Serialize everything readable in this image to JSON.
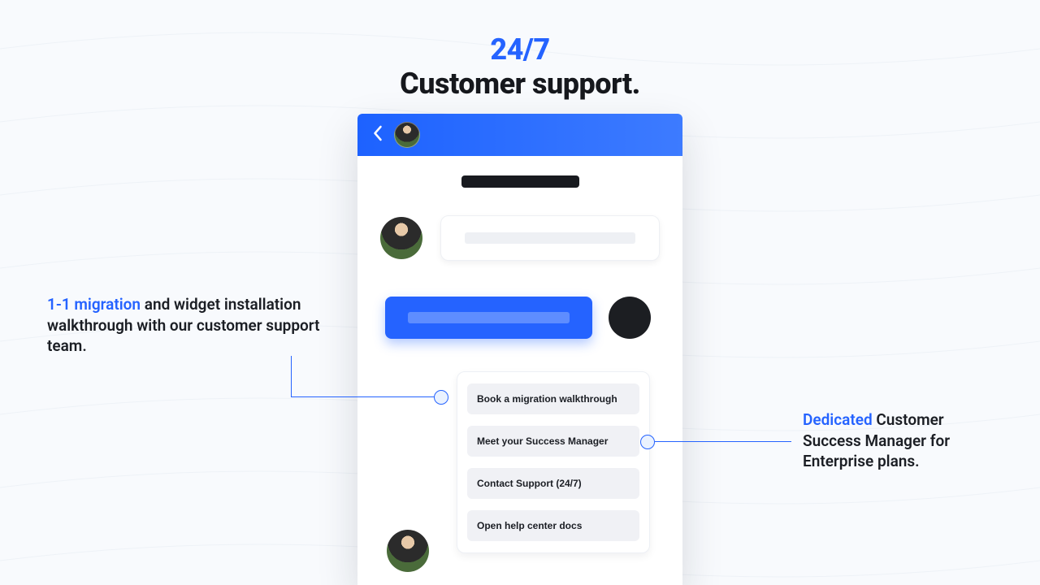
{
  "headline": {
    "line1": "24/7",
    "line2": "Customer support."
  },
  "callouts": {
    "left": {
      "highlight": "1-1 migration",
      "rest": " and widget installation walkthrough with our customer support team."
    },
    "right": {
      "highlight": "Dedicated",
      "rest": " Customer Success Manager for Enterprise plans."
    }
  },
  "chat": {
    "options": [
      "Book a migration walkthrough",
      "Meet your Success Manager",
      "Contact Support (24/7)",
      "Open help center docs"
    ]
  },
  "colors": {
    "accent": "#2563ff"
  }
}
